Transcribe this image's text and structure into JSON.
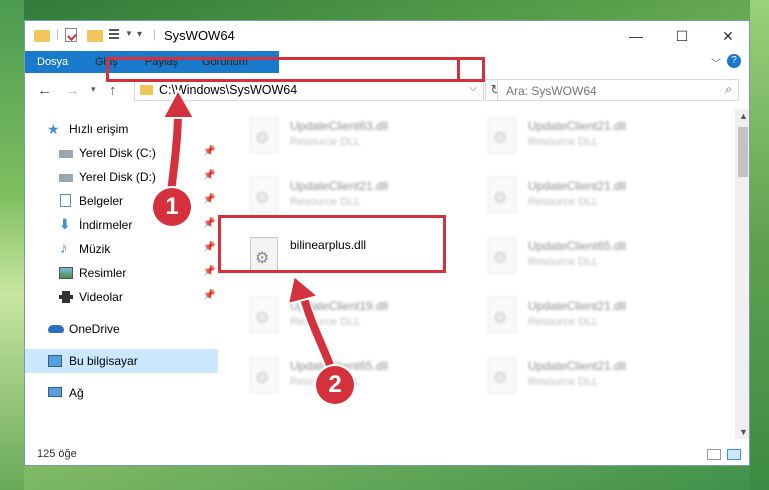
{
  "window": {
    "title": "SysWOW64",
    "minimize_glyph": "—",
    "maximize_glyph": "☐",
    "close_glyph": "✕"
  },
  "ribbon": {
    "tabs": [
      "Dosya",
      "Giriş",
      "Paylaş",
      "Görünüm"
    ],
    "help_glyph": "?"
  },
  "address": {
    "path": "C:\\Windows\\SysWOW64"
  },
  "search": {
    "placeholder": "Ara: SysWOW64"
  },
  "nav": {
    "items": [
      {
        "label": "Hızlı erişim",
        "icon": "star-icon"
      },
      {
        "label": "Yerel Disk (C:)",
        "icon": "drive-c-icon"
      },
      {
        "label": "Yerel Disk (D:)",
        "icon": "drive-d-icon"
      },
      {
        "label": "Belgeler",
        "icon": "documents-icon"
      },
      {
        "label": "İndirmeler",
        "icon": "downloads-icon"
      },
      {
        "label": "Müzik",
        "icon": "music-icon"
      },
      {
        "label": "Resimler",
        "icon": "pictures-icon"
      },
      {
        "label": "Videolar",
        "icon": "videos-icon"
      },
      {
        "label": "OneDrive",
        "icon": "cloud-icon"
      },
      {
        "label": "Bu bilgisayar",
        "icon": "computer-icon"
      },
      {
        "label": "Ağ",
        "icon": "network-icon"
      }
    ]
  },
  "files": [
    {
      "name": "UpdateClient63.dll",
      "type": "Resource DLL"
    },
    {
      "name": "UpdateClient21.dll",
      "type": "Resource DLL"
    },
    {
      "name": "UpdateClient21.dll",
      "type": "Resource DLL"
    },
    {
      "name": "UpdateClient21.dll",
      "type": "Resource DLL"
    },
    {
      "name": "bilinearplus.dll",
      "type": ""
    },
    {
      "name": "UpdateClient65.dll",
      "type": "Resource DLL"
    },
    {
      "name": "UpdateClient19.dll",
      "type": "Resource DLL"
    },
    {
      "name": "UpdateClient21.dll",
      "type": "Resource DLL"
    },
    {
      "name": "UpdateClient65.dll",
      "type": "Resource DLL"
    },
    {
      "name": "UpdateClient21.dll",
      "type": "Resource DLL"
    }
  ],
  "status": {
    "count": "125 öğe"
  },
  "annotations": {
    "step1": "1",
    "step2": "2",
    "color": "#d5313c"
  }
}
